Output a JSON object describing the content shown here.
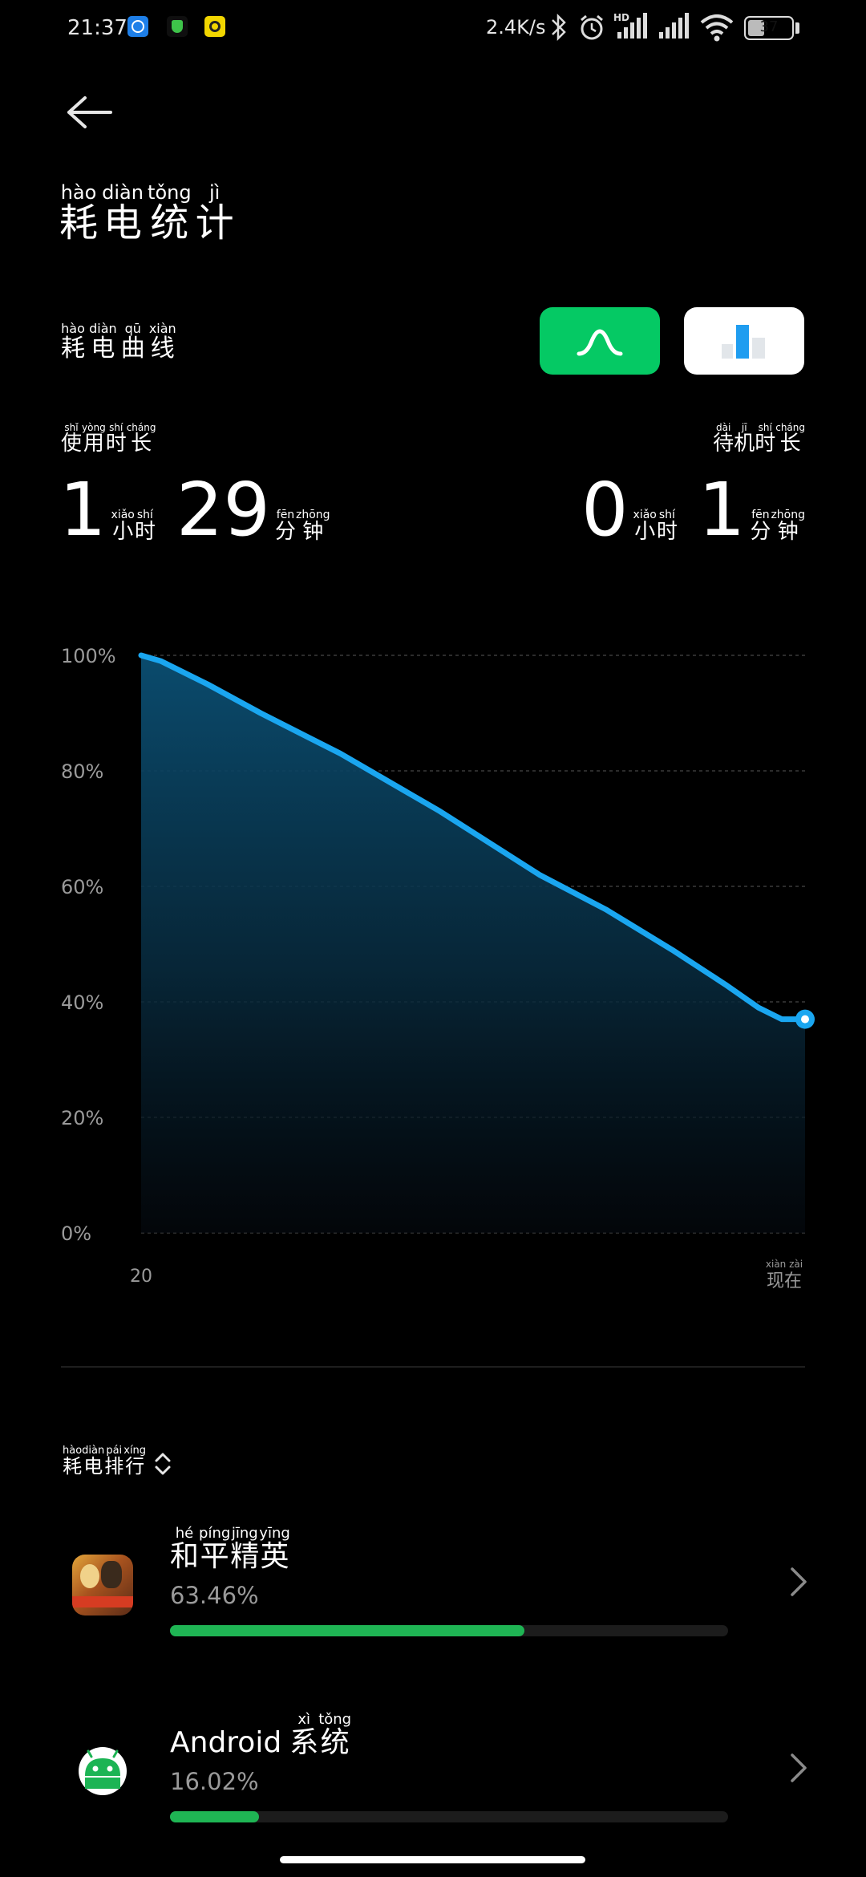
{
  "status_bar": {
    "time": "21:37",
    "net_speed": "2.4K/s",
    "battery": "37",
    "notification_icons": [
      "kugou-icon",
      "shield-app-icon",
      "yellow-app-icon"
    ],
    "right_icons": [
      "bluetooth-icon",
      "alarm-icon",
      "hd-signal-icon",
      "signal-icon",
      "wifi-icon",
      "battery-icon"
    ]
  },
  "header": {
    "title_pinyin": [
      "hào",
      "diàn",
      "tǒng",
      "jì"
    ],
    "title_chars": [
      "耗",
      "电",
      "统",
      "计"
    ]
  },
  "curve_section": {
    "label_pinyin": [
      "hào",
      "diàn",
      "qū",
      "xiàn"
    ],
    "label_chars": [
      "耗",
      "电",
      "曲",
      "线"
    ],
    "curve_button_icon": "curve-icon",
    "bar_button_icon": "bar-chart-icon"
  },
  "usage": {
    "label_pinyin": [
      "shǐ",
      "yòng",
      "shí",
      "cháng"
    ],
    "label_chars": [
      "使",
      "用",
      "时",
      "长"
    ],
    "hours": "1",
    "minutes": "29",
    "hour_unit_pinyin": [
      "xiǎo",
      "shí"
    ],
    "hour_unit_chars": [
      "小",
      "时"
    ],
    "minute_unit_pinyin": [
      "fēn",
      "zhōng"
    ],
    "minute_unit_chars": [
      "分",
      "钟"
    ]
  },
  "standby": {
    "label_pinyin": [
      "dài",
      "jī",
      "shí",
      "cháng"
    ],
    "label_chars": [
      "待",
      "机",
      "时",
      "长"
    ],
    "hours": "0",
    "minutes": "1",
    "hour_unit_pinyin": [
      "xiǎo",
      "shí"
    ],
    "hour_unit_chars": [
      "小",
      "时"
    ],
    "minute_unit_pinyin": [
      "fēn",
      "zhōng"
    ],
    "minute_unit_chars": [
      "分",
      "钟"
    ]
  },
  "chart_data": {
    "type": "area",
    "title": "",
    "xlabel": "",
    "ylabel": "",
    "ylim": [
      0,
      100
    ],
    "y_ticks": [
      "100%",
      "80%",
      "60%",
      "40%",
      "20%",
      "0%"
    ],
    "y_tick_values": [
      100,
      80,
      60,
      40,
      20,
      0
    ],
    "x_start_label": "20",
    "x_end_label_pinyin": [
      "xiàn",
      "zài"
    ],
    "x_end_label_chars": [
      "现",
      "在"
    ],
    "x_range": [
      0,
      1
    ],
    "grid": true,
    "series": [
      {
        "x": [
          0,
          0.03,
          0.1,
          0.18,
          0.3,
          0.45,
          0.6,
          0.7,
          0.8,
          0.88,
          0.93,
          0.965,
          1
        ],
        "values": [
          100,
          99,
          95,
          90,
          83,
          73,
          62,
          56,
          49,
          43,
          39,
          37,
          37
        ]
      }
    ],
    "colors": {
      "line": "#1aa6f0",
      "fill": "#0b4f73",
      "grid": "#3a3a3a"
    }
  },
  "ranking": {
    "label_pinyin": [
      "hào",
      "diàn",
      "pái",
      "xíng"
    ],
    "label_chars": [
      "耗",
      "电",
      "排",
      "行"
    ],
    "sort_icon": "sort-toggle-icon",
    "apps": [
      {
        "name_pinyin": [
          "hé",
          "píng",
          "jīng",
          "yīng"
        ],
        "name_chars": [
          "和",
          "平",
          "精",
          "英"
        ],
        "name_prefix": "",
        "percent_text": "63.46%",
        "percent": 63.46,
        "icon": "peace-elite-app-icon"
      },
      {
        "name_pinyin": [
          "xì",
          "tǒng"
        ],
        "name_chars": [
          "系",
          "统"
        ],
        "name_prefix": "Android",
        "percent_text": "16.02%",
        "percent": 16.02,
        "icon": "android-icon"
      }
    ]
  }
}
